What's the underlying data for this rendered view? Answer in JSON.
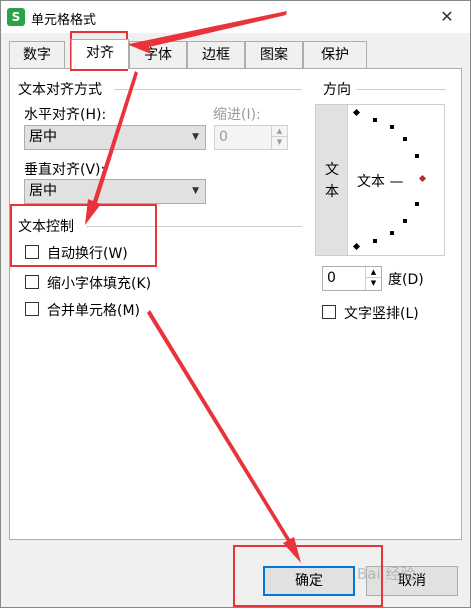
{
  "window": {
    "title": "单元格格式",
    "app_icon_letter": "S",
    "close_glyph": "✕"
  },
  "tabs": [
    {
      "label": "数字"
    },
    {
      "label": "对齐"
    },
    {
      "label": "字体"
    },
    {
      "label": "边框"
    },
    {
      "label": "图案"
    },
    {
      "label": "保护"
    }
  ],
  "alignment": {
    "group_label": "文本对齐方式",
    "horizontal_label": "水平对齐(H):",
    "horizontal_value": "居中",
    "indent_label": "缩进(I):",
    "indent_value": "0",
    "vertical_label": "垂直对齐(V):",
    "vertical_value": "居中"
  },
  "text_control": {
    "group_label": "文本控制",
    "items": [
      {
        "label": "自动换行(W)",
        "checked": false
      },
      {
        "label": "缩小字体填充(K)",
        "checked": false
      },
      {
        "label": "合并单元格(M)",
        "checked": false
      }
    ]
  },
  "orientation": {
    "group_label": "方向",
    "vertical_text": [
      "文",
      "本"
    ],
    "dial_label": "文本 —",
    "degree_value": "0",
    "degree_label": "度(D)",
    "vertical_stack_label": "文字竖排(L)"
  },
  "footer": {
    "ok_label": "确定",
    "cancel_label": "取消"
  },
  "watermark": "Bai 经验",
  "colors": {
    "annotation": "#e8333a",
    "accent": "#0078d7",
    "dial_marker": "#c0262d"
  }
}
